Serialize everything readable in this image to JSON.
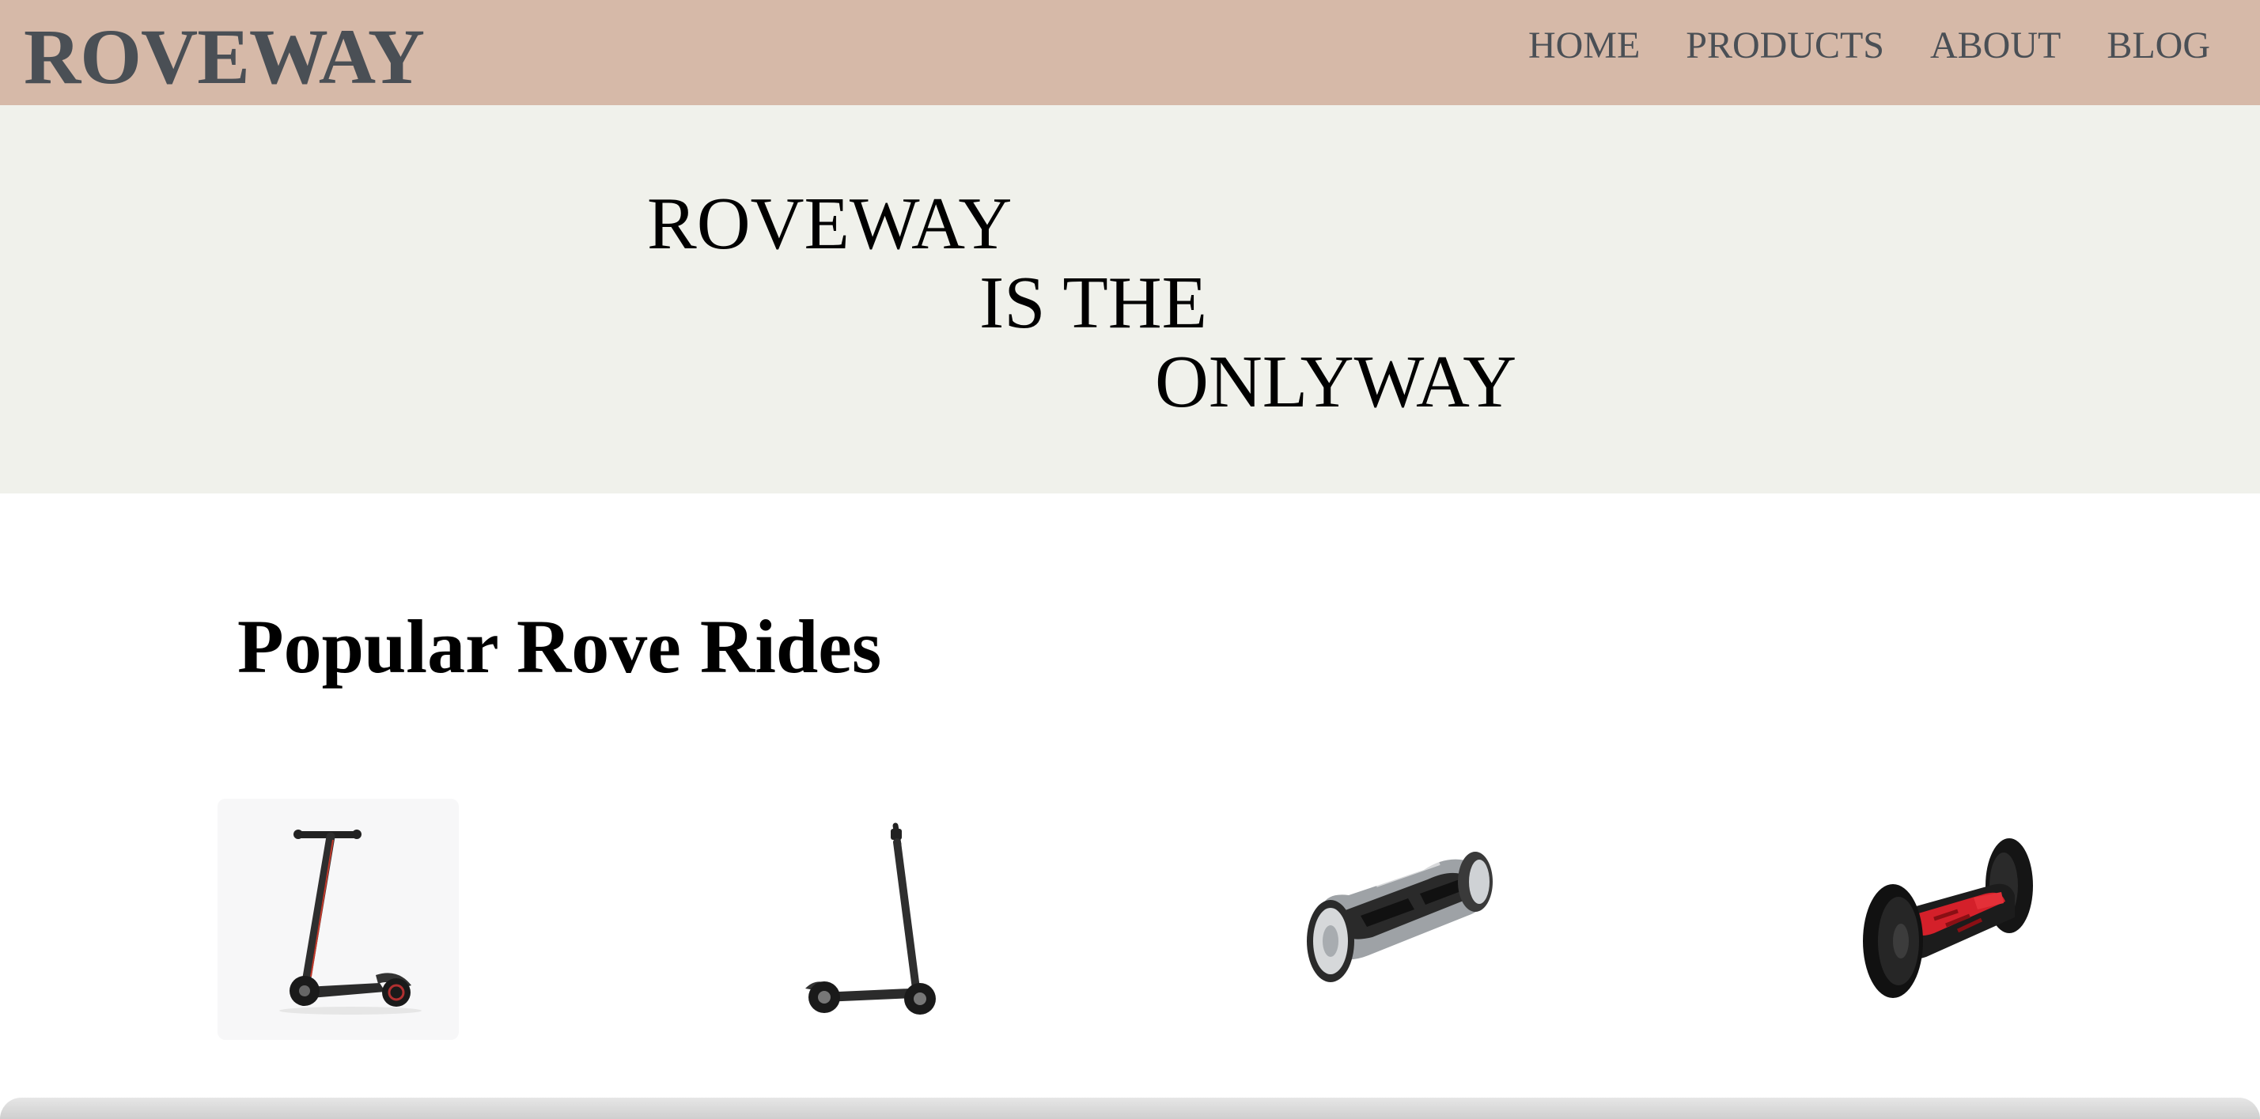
{
  "header": {
    "logo": "ROVEWAY",
    "nav": [
      "HOME",
      "PRODUCTS",
      "ABOUT",
      "BLOG"
    ]
  },
  "hero": {
    "lines": [
      "ROVEWAY",
      "IS THE",
      "ONLYWAY"
    ]
  },
  "section": {
    "title": "Popular Rove Rides"
  },
  "products": [
    {
      "icon": "electric-scooter-icon"
    },
    {
      "icon": "electric-scooter-icon"
    },
    {
      "icon": "hoverboard-icon"
    },
    {
      "icon": "hoverboard-icon"
    }
  ],
  "colors": {
    "header_bg": "#d6b9a8",
    "hero_bg": "#f0f1eb",
    "logo_text": "#4a4f55",
    "accent_red": "#d4202a"
  }
}
